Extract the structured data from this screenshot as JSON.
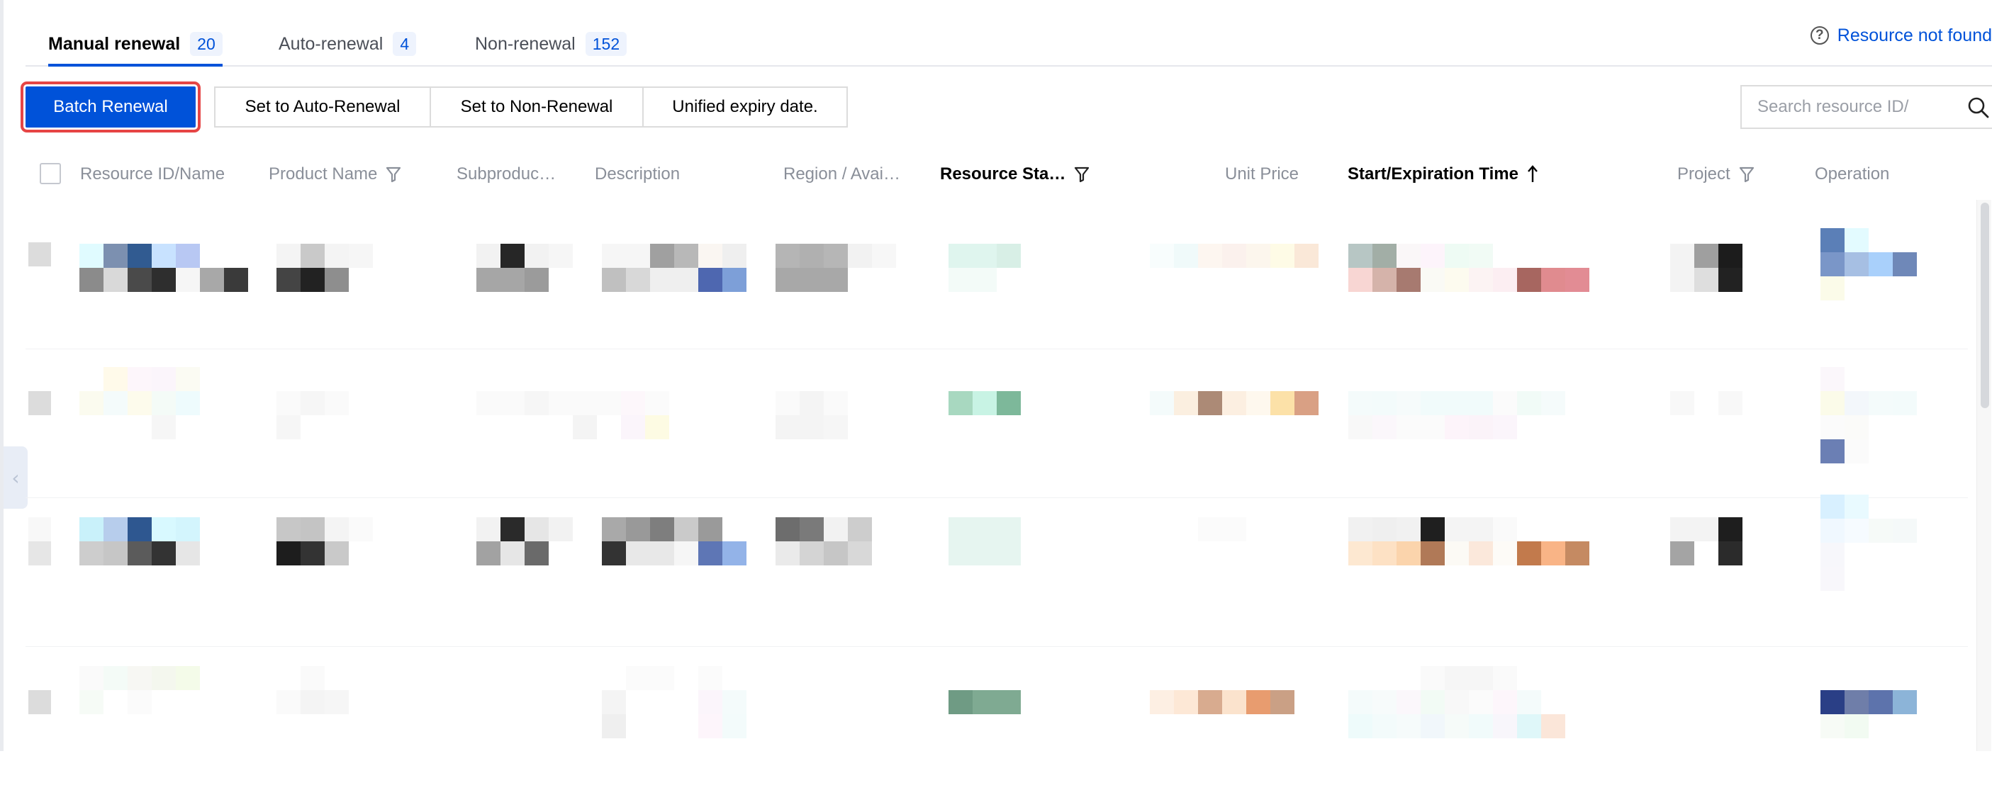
{
  "tabs": [
    {
      "label": "Manual renewal",
      "count": "20"
    },
    {
      "label": "Auto-renewal",
      "count": "4"
    },
    {
      "label": "Non-renewal",
      "count": "152"
    }
  ],
  "help_link": "Resource not found",
  "toolbar": {
    "batch_renewal": "Batch Renewal",
    "set_auto": "Set to Auto-Renewal",
    "set_non": "Set to Non-Renewal",
    "unified_expiry": "Unified expiry date."
  },
  "search": {
    "placeholder": "Search resource ID/"
  },
  "columns": [
    {
      "label": "Resource ID/Name"
    },
    {
      "label": "Product Name"
    },
    {
      "label": "Subproduc…"
    },
    {
      "label": "Description"
    },
    {
      "label": "Region / Avai…"
    },
    {
      "label": "Resource Sta…"
    },
    {
      "label": "Unit Price"
    },
    {
      "label": "Start/Expiration Time"
    },
    {
      "label": "Project"
    },
    {
      "label": "Operation"
    }
  ],
  "icons": {
    "filter": "filter-icon",
    "sort": "arrow-up-icon",
    "search": "search-icon",
    "help": "question-circle-icon",
    "collapse": "chevron-left-icon"
  },
  "colors": {
    "accent": "#0052d9",
    "highlight_outline": "#e64545",
    "muted_text": "#8a8f99"
  }
}
